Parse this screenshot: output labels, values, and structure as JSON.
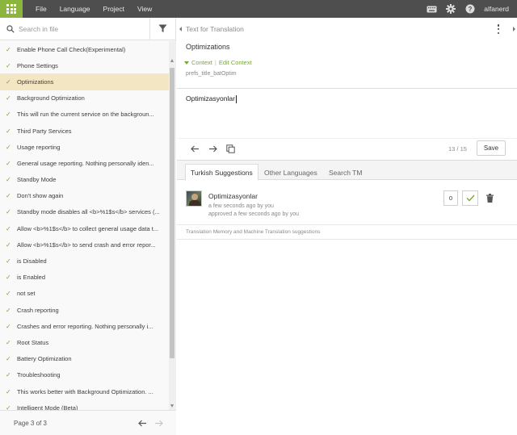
{
  "topbar": {
    "menu": [
      "File",
      "Language",
      "Project",
      "View"
    ],
    "username": "alfanerd",
    "icons": [
      "keyboard-icon",
      "gear-icon",
      "help-icon"
    ]
  },
  "left_panel": {
    "search_placeholder": "Search in file",
    "items": [
      {
        "label": "Enable Phone Call Check(Experimental)",
        "done": true,
        "active": false
      },
      {
        "label": "Phone Settings",
        "done": true,
        "active": false
      },
      {
        "label": "Optimizations",
        "done": true,
        "active": true
      },
      {
        "label": "Background Optimization",
        "done": true,
        "active": false
      },
      {
        "label": "This will run the current service on the backgroun...",
        "done": true,
        "active": false
      },
      {
        "label": "Third Party Services",
        "done": true,
        "active": false
      },
      {
        "label": "Usage reporting",
        "done": true,
        "active": false
      },
      {
        "label": "General usage reporting. Nothing personally iden...",
        "done": true,
        "active": false
      },
      {
        "label": "Standby Mode",
        "done": true,
        "active": false
      },
      {
        "label": "Don't show again",
        "done": true,
        "active": false
      },
      {
        "label": "Standby mode disables all <b>%1$s</b> services (...",
        "done": true,
        "active": false
      },
      {
        "label": "Allow <b>%1$s</b> to collect general usage data t...",
        "done": true,
        "active": false
      },
      {
        "label": "Allow <b>%1$s</b> to send crash and error repor...",
        "done": true,
        "active": false
      },
      {
        "label": "is Disabled",
        "done": true,
        "active": false
      },
      {
        "label": "is Enabled",
        "done": true,
        "active": false
      },
      {
        "label": "not set",
        "done": true,
        "active": false
      },
      {
        "label": "Crash reporting",
        "done": true,
        "active": false
      },
      {
        "label": "Crashes and error reporting. Nothing personally i...",
        "done": true,
        "active": false
      },
      {
        "label": "Root Status",
        "done": true,
        "active": false
      },
      {
        "label": "Battery Optimization",
        "done": true,
        "active": false
      },
      {
        "label": "Troubleshooting",
        "done": true,
        "active": false
      },
      {
        "label": "This works better with Background Optimization. ...",
        "done": true,
        "active": false
      },
      {
        "label": "Intelligent Mode (Beta)",
        "done": true,
        "active": false
      }
    ],
    "page_label": "Page 3 of 3"
  },
  "source": {
    "header": "Text for Translation",
    "text": "Optimizations",
    "context_label": "Context",
    "edit_context_label": "Edit Context",
    "key": "prefs_title_batOptim"
  },
  "editor": {
    "value": "Optimizasyonlar",
    "counter": "13 / 15",
    "save_label": "Save"
  },
  "tabs": [
    "Turkish Suggestions",
    "Other Languages",
    "Search TM"
  ],
  "suggestion": {
    "text": "Optimizasyonlar",
    "meta1": "a few seconds ago by you",
    "meta2": "approved a few seconds ago by you",
    "votes": "0"
  },
  "tm_label": "Translation Memory and Machine Translation suggestions",
  "colors": {
    "accent": "#7aa63a",
    "topbar": "#4e4e4e",
    "active_row": "#f3e7c3",
    "apps_button": "#8cb53d"
  }
}
